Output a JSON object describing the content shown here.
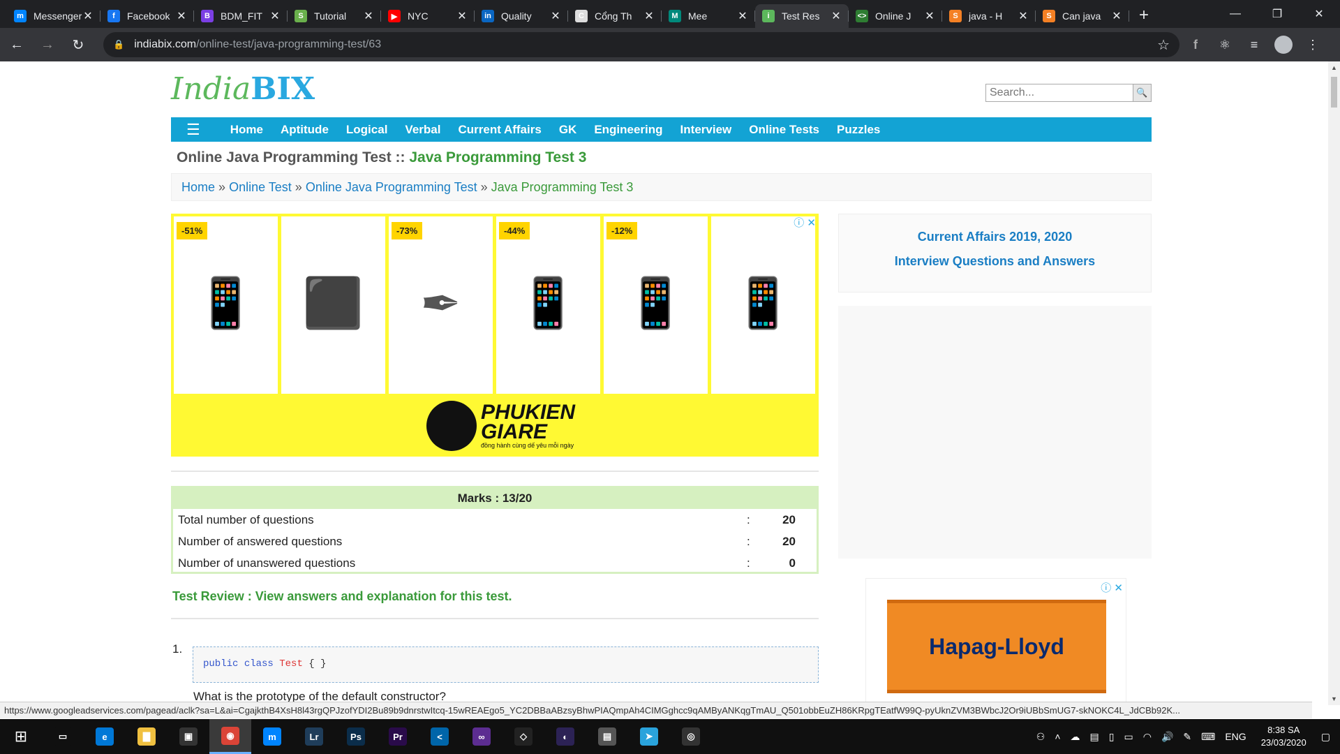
{
  "browser": {
    "tabs": [
      {
        "title": "Messenger",
        "color": "#0084ff",
        "glyph": "m"
      },
      {
        "title": "Facebook",
        "color": "#1877f2",
        "glyph": "f"
      },
      {
        "title": "BDM_FIT",
        "color": "#7b3fe4",
        "glyph": "B"
      },
      {
        "title": "Tutorial",
        "color": "#6ab04c",
        "glyph": "S"
      },
      {
        "title": "NYC",
        "color": "#ff0000",
        "glyph": "▶"
      },
      {
        "title": "Quality",
        "color": "#0a66c2",
        "glyph": "in"
      },
      {
        "title": "Cổng Th",
        "color": "#dddddd",
        "glyph": "C"
      },
      {
        "title": "Mee",
        "color": "#00897b",
        "glyph": "M"
      },
      {
        "title": "Test Res",
        "color": "#5cb85c",
        "glyph": "i"
      },
      {
        "title": "Online J",
        "color": "#2e7d32",
        "glyph": "<>"
      },
      {
        "title": "java - H",
        "color": "#f48024",
        "glyph": "S"
      },
      {
        "title": "Can java",
        "color": "#f48024",
        "glyph": "S"
      }
    ],
    "active_tab_index": 8,
    "url_host": "indiabix.com",
    "url_path": "/online-test/java-programming-test/63"
  },
  "site": {
    "logo_india": "India",
    "logo_bix": "BIX",
    "search_placeholder": "Search...",
    "menu": [
      "Home",
      "Aptitude",
      "Logical",
      "Verbal",
      "Current Affairs",
      "GK",
      "Engineering",
      "Interview",
      "Online Tests",
      "Puzzles"
    ]
  },
  "page": {
    "title_prefix": "Online Java Programming Test ::",
    "title_test": "Java Programming Test 3",
    "breadcrumbs": [
      "Home",
      "Online Test",
      "Online Java Programming Test"
    ],
    "breadcrumb_current": "Java Programming Test 3"
  },
  "ad": {
    "cards": [
      {
        "badge": "-51%"
      },
      {
        "badge": ""
      },
      {
        "badge": "-73%"
      },
      {
        "badge": "-44%"
      },
      {
        "badge": "-12%"
      },
      {
        "badge": ""
      }
    ],
    "brand_line1": "PHUKIEN",
    "brand_line2": "GIARE",
    "brand_sub": "đồng hành cùng dế yêu mỗi ngày"
  },
  "results": {
    "marks_label": "Marks : 13/20",
    "rows": [
      {
        "label": "Total number of questions",
        "value": "20"
      },
      {
        "label": "Number of answered questions",
        "value": "20"
      },
      {
        "label": "Number of unanswered questions",
        "value": "0"
      }
    ],
    "review_text": "Test Review : View answers and explanation for this test."
  },
  "question": {
    "number": "1.",
    "code_kw1": "public",
    "code_kw2": "class",
    "code_cls": "Test",
    "code_rest": "{ }",
    "text": "What is the prototype of the default constructor?"
  },
  "sidebar": {
    "link1": "Current Affairs 2019, 2020",
    "link2": "Interview Questions and Answers",
    "ad2_label": "Hapag-Lloyd"
  },
  "statusbar": {
    "url": "https://www.googleadservices.com/pagead/aclk?sa=L&ai=CgajkthB4XsH8l43rgQPJzofYDI2Bu89b9dnrstwItcq-15wREAEgo5_YC2DBBaABzsyBhwPIAQmpAh4CIMGghcc9qAMByANKqgTmAU_Q501obbEuZH86KRpgTEatfW99Q-pyUknZVM3BWbcJ2Or9iUBbSmUG7-skNOKC4L_JdCBb92K..."
  },
  "taskbar": {
    "apps": [
      {
        "name": "task-view",
        "color": "#101010",
        "glyph": "▭"
      },
      {
        "name": "edge",
        "color": "#0078d7",
        "glyph": "e"
      },
      {
        "name": "file-explorer",
        "color": "#f0c040",
        "glyph": "▇"
      },
      {
        "name": "store",
        "color": "#333333",
        "glyph": "▣"
      },
      {
        "name": "chrome",
        "color": "#db4437",
        "glyph": "◉"
      },
      {
        "name": "messenger",
        "color": "#0084ff",
        "glyph": "m"
      },
      {
        "name": "lightroom",
        "color": "#1f3d5a",
        "glyph": "Lr"
      },
      {
        "name": "photoshop",
        "color": "#0b2d4a",
        "glyph": "Ps"
      },
      {
        "name": "premiere",
        "color": "#2a0b4a",
        "glyph": "Pr"
      },
      {
        "name": "vscode",
        "color": "#0065a9",
        "glyph": "<"
      },
      {
        "name": "visual-studio",
        "color": "#5c2d91",
        "glyph": "∞"
      },
      {
        "name": "unity",
        "color": "#222222",
        "glyph": "◇"
      },
      {
        "name": "eclipse",
        "color": "#2c2255",
        "glyph": "◐"
      },
      {
        "name": "photos",
        "color": "#555555",
        "glyph": "▤"
      },
      {
        "name": "telegram",
        "color": "#2aa3dc",
        "glyph": "➤"
      },
      {
        "name": "obs",
        "color": "#333333",
        "glyph": "◎"
      }
    ],
    "active_app": "chrome",
    "language": "ENG",
    "time": "8:38 SA",
    "date": "23/03/2020"
  }
}
